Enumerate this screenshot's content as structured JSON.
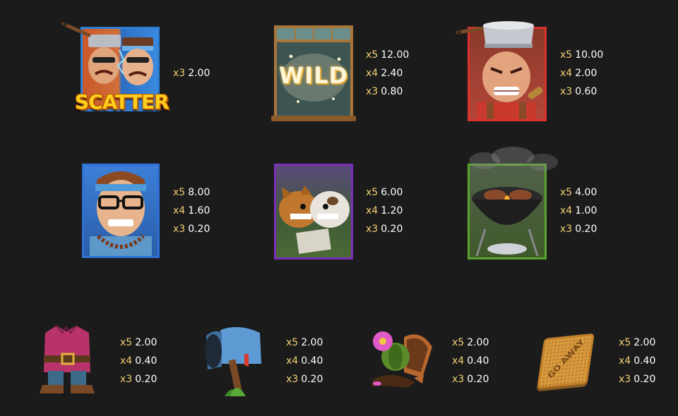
{
  "screen": "paytable",
  "colors": {
    "background": "#1b1b1b",
    "multiplier_text": "#f2cf73",
    "payout_text": "#ffffff",
    "frame_scatter": "#2d7fd6",
    "frame_wild": "#a8753a",
    "frame_red": "#d9322e",
    "frame_blue": "#2f6fd6",
    "frame_purple": "#7a2fb8",
    "frame_green": "#5aa32f"
  },
  "symbols": [
    {
      "id": "scatter",
      "name": "scatter-symbol",
      "label": "SCATTER",
      "icon": "two-neighbors-scatter-icon",
      "pays": [
        {
          "mult": "x3",
          "value": "2.00"
        }
      ]
    },
    {
      "id": "wild",
      "name": "wild-symbol",
      "label": "WILD",
      "icon": "wild-window-icon",
      "pays": [
        {
          "mult": "x5",
          "value": "12.00"
        },
        {
          "mult": "x4",
          "value": "2.40"
        },
        {
          "mult": "x3",
          "value": "0.80"
        }
      ]
    },
    {
      "id": "angry-man",
      "name": "angry-pot-man-symbol",
      "icon": "angry-man-pot-hat-icon",
      "pays": [
        {
          "mult": "x5",
          "value": "10.00"
        },
        {
          "mult": "x4",
          "value": "2.00"
        },
        {
          "mult": "x3",
          "value": "0.60"
        }
      ]
    },
    {
      "id": "glasses-man",
      "name": "glasses-neighbor-symbol",
      "icon": "neighbor-glasses-headband-icon",
      "pays": [
        {
          "mult": "x5",
          "value": "8.00"
        },
        {
          "mult": "x4",
          "value": "1.60"
        },
        {
          "mult": "x3",
          "value": "0.20"
        }
      ]
    },
    {
      "id": "dogs",
      "name": "dogs-symbol",
      "icon": "fighting-dogs-icon",
      "pays": [
        {
          "mult": "x5",
          "value": "6.00"
        },
        {
          "mult": "x4",
          "value": "1.20"
        },
        {
          "mult": "x3",
          "value": "0.20"
        }
      ]
    },
    {
      "id": "bbq",
      "name": "bbq-grill-symbol",
      "icon": "bbq-grill-icon",
      "pays": [
        {
          "mult": "x5",
          "value": "4.00"
        },
        {
          "mult": "x4",
          "value": "1.00"
        },
        {
          "mult": "x3",
          "value": "0.20"
        }
      ]
    },
    {
      "id": "gnome",
      "name": "garden-gnome-symbol",
      "icon": "broken-gnome-icon",
      "pays": [
        {
          "mult": "x5",
          "value": "2.00"
        },
        {
          "mult": "x4",
          "value": "0.40"
        },
        {
          "mult": "x3",
          "value": "0.20"
        }
      ]
    },
    {
      "id": "mailbox",
      "name": "mailbox-symbol",
      "icon": "broken-mailbox-icon",
      "pays": [
        {
          "mult": "x5",
          "value": "2.00"
        },
        {
          "mult": "x4",
          "value": "0.40"
        },
        {
          "mult": "x3",
          "value": "0.20"
        }
      ]
    },
    {
      "id": "flowerpot",
      "name": "flowerpot-symbol",
      "icon": "broken-flowerpot-icon",
      "pays": [
        {
          "mult": "x5",
          "value": "2.00"
        },
        {
          "mult": "x4",
          "value": "0.40"
        },
        {
          "mult": "x3",
          "value": "0.20"
        }
      ]
    },
    {
      "id": "doormat",
      "name": "doormat-symbol",
      "label": "GO AWAY",
      "icon": "doormat-icon",
      "pays": [
        {
          "mult": "x5",
          "value": "2.00"
        },
        {
          "mult": "x4",
          "value": "0.40"
        },
        {
          "mult": "x3",
          "value": "0.20"
        }
      ]
    }
  ]
}
